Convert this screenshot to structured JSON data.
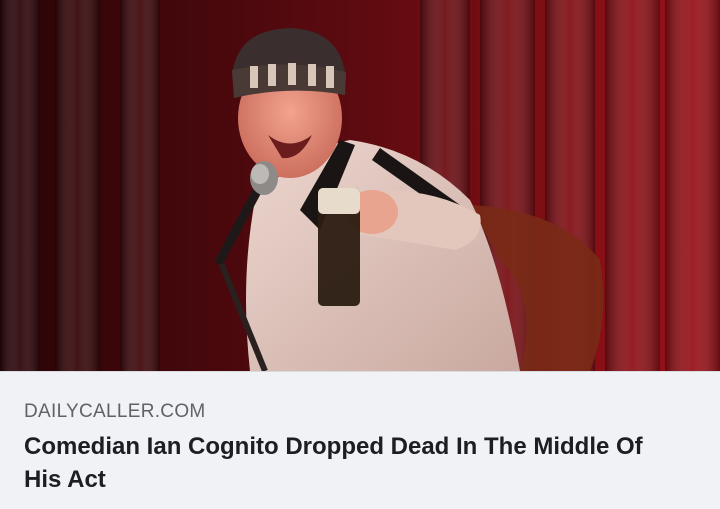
{
  "link_preview": {
    "image_alt": "Comedian on stage holding a microphone and a glass",
    "domain": "DAILYCALLER.COM",
    "headline": "Comedian Ian Cognito Dropped Dead In The Middle Of His Act"
  },
  "colors": {
    "curtain": "#7a0d12",
    "meta_background": "#f0f2f5",
    "domain_text": "#5f6368",
    "headline_text": "#1c1e21"
  }
}
